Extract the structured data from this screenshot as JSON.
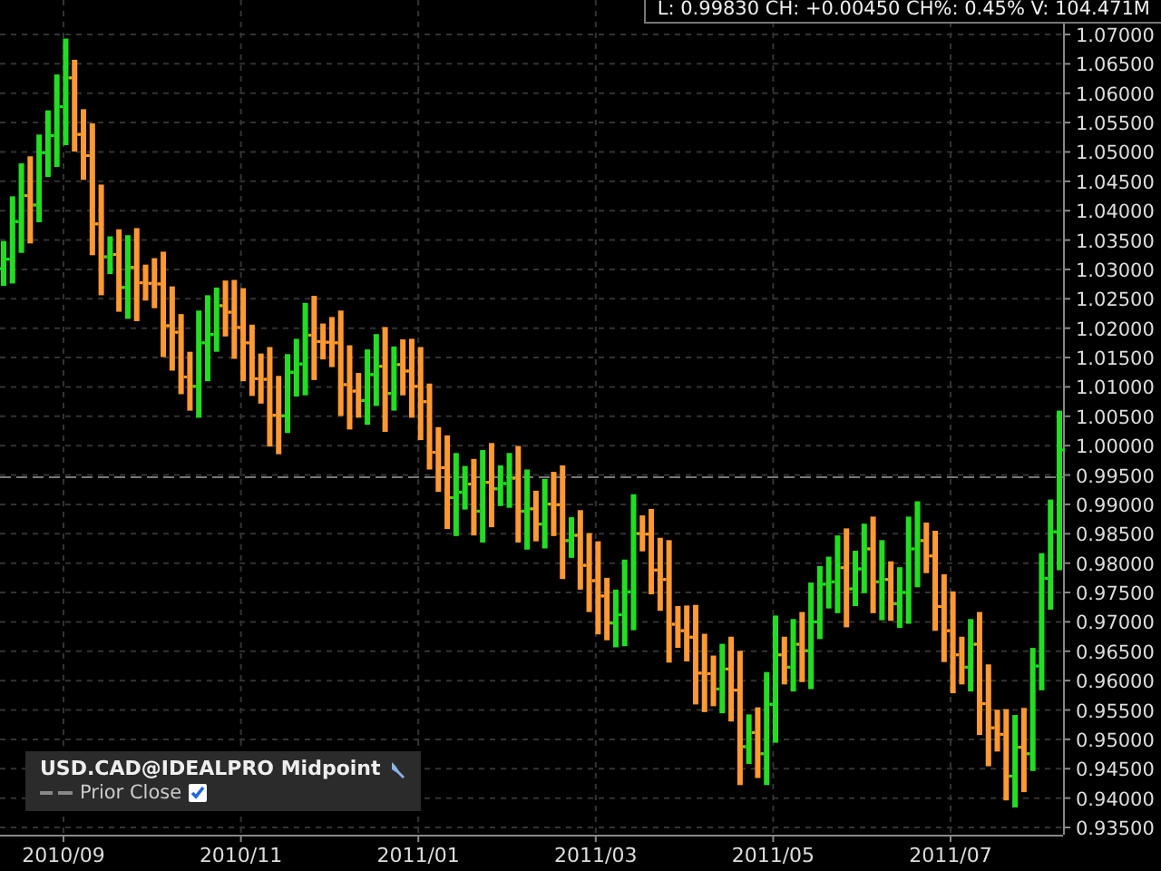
{
  "header": {
    "quote": "L: 0.99830 CH: +0.00450 CH%: 0.45% V: 104.471M"
  },
  "legend": {
    "title": "USD.CAD@IDEALPRO Midpoint",
    "prior_close": {
      "label": "Prior Close",
      "checked": true
    }
  },
  "y_axis_labels": [
    "1.07000",
    "1.06500",
    "1.06000",
    "1.05500",
    "1.05000",
    "1.04500",
    "1.04000",
    "1.03500",
    "1.03000",
    "1.02500",
    "1.02000",
    "1.01500",
    "1.01000",
    "1.00500",
    "1.00000",
    "0.99500",
    "0.99000",
    "0.98500",
    "0.98000",
    "0.97500",
    "0.97000",
    "0.96500",
    "0.96000",
    "0.95500",
    "0.95000",
    "0.94500",
    "0.94000",
    "0.93500"
  ],
  "x_axis_labels": [
    "2010/09",
    "2010/11",
    "2011/01",
    "2011/03",
    "2011/05",
    "2011/07"
  ]
}
